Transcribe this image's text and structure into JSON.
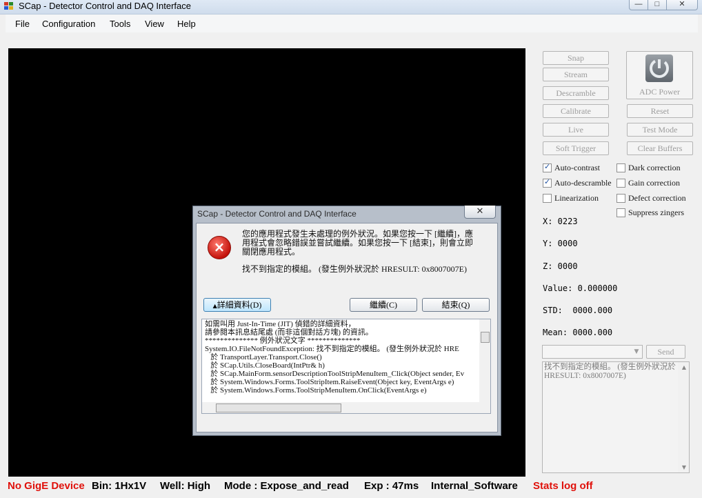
{
  "window": {
    "title": "SCap - Detector Control and DAQ Interface",
    "min": "—",
    "max": "□",
    "close": "✕"
  },
  "menu": [
    "File",
    "Configuration",
    "Tools",
    "View",
    "Help"
  ],
  "buttons": {
    "snap": "Snap",
    "stream": "Stream",
    "descramble": "Descramble",
    "calibrate": "Calibrate",
    "live": "Live",
    "soft_trigger": "Soft Trigger",
    "adc_power": "ADC Power",
    "reset": "Reset",
    "test_mode": "Test Mode",
    "clear_buffers": "Clear Buffers",
    "send": "Send"
  },
  "checkboxes": [
    {
      "label": "Auto-contrast",
      "checked": true
    },
    {
      "label": "Auto-descramble",
      "checked": true
    },
    {
      "label": "Linearization",
      "checked": false
    },
    {
      "label": "Dark correction",
      "checked": false
    },
    {
      "label": "Gain correction",
      "checked": false
    },
    {
      "label": "Defect correction",
      "checked": false
    },
    {
      "label": "Suppress zingers",
      "checked": false
    }
  ],
  "readouts": {
    "x": "X: 0223",
    "y": "Y: 0000",
    "z": "Z: 0000",
    "value": "Value: 0.000000",
    "std": "STD:  0000.000",
    "mean": "Mean: 0000.000"
  },
  "log": {
    "text": "找不到指定的模組。 (發生例外狀況於 HRESULT: 0x8007007E)"
  },
  "dialog": {
    "title": "SCap - Detector Control and DAQ Interface",
    "close": "✕",
    "icon": "×",
    "message_lines": [
      "您的應用程式發生未處理的例外狀況。如果您按一下 [繼續]，應",
      "用程式會忽略錯誤並嘗試繼續。如果您按一下 [結束]，則會立即",
      "關閉應用程式。"
    ],
    "error_line": "找不到指定的模組。 (發生例外狀況於 HRESULT: 0x8007007E)",
    "details_button": "詳細資料(D)",
    "continue_button": "繼續(C)",
    "quit_button": "結束(Q)",
    "details_lines": [
      "如需叫用 Just-In-Time (JIT) 偵錯的詳細資料，",
      "請參閱本訊息結尾處 (而非這個對話方塊) 的資訊。",
      "",
      "************** 例外狀況文字 **************",
      "System.IO.FileNotFoundException: 找不到指定的模組。 (發生例外狀況於 HRE",
      "   於 TransportLayer.Transport.Close()",
      "   於 SCap.Utils.CloseBoard(IntPtr& h)",
      "   於 SCap.MainForm.sensorDescriptionToolStripMenuItem_Click(Object sender, Ev",
      "   於 System.Windows.Forms.ToolStripItem.RaiseEvent(Object key, EventArgs e)",
      "   於 System.Windows.Forms.ToolStripMenuItem.OnClick(EventArgs e)"
    ]
  },
  "status": {
    "device": "No GigE Device",
    "bin": "Bin: 1Hx1V",
    "well": "Well: High",
    "mode": "Mode : Expose_and_read",
    "exp": "Exp : 47ms",
    "trigger": "Internal_Software",
    "stats": "Stats log off"
  },
  "colors": {
    "error_red": "#e0110b",
    "disabled_text": "#9c9c9c"
  }
}
